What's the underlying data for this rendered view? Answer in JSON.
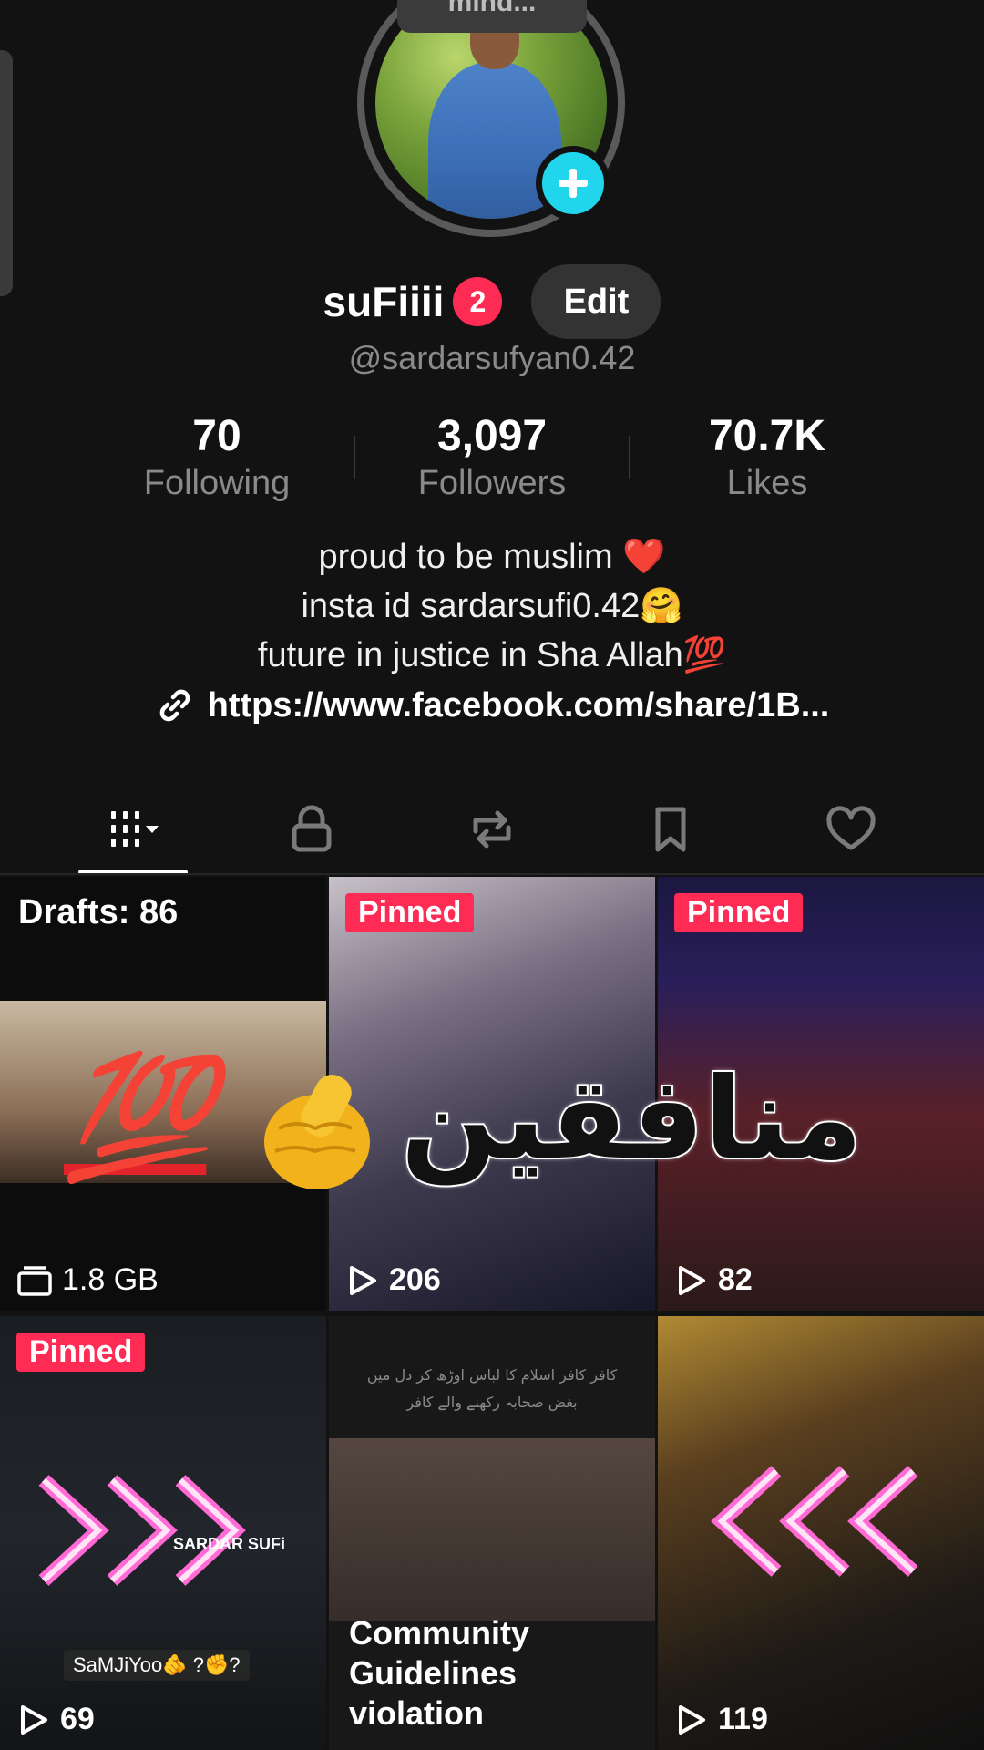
{
  "profile": {
    "tooltip": "mind...",
    "username": "suFiiii",
    "badge_count": "2",
    "edit_label": "Edit",
    "handle": "@sardarsufyan0.42"
  },
  "stats": [
    {
      "value": "70",
      "label": "Following"
    },
    {
      "value": "3,097",
      "label": "Followers"
    },
    {
      "value": "70.7K",
      "label": "Likes"
    }
  ],
  "bio": {
    "lines": [
      "proud to be muslim ❤️",
      "insta id sardarsufi0.42🤗",
      "future in justice in Sha Allah💯"
    ],
    "link": "https://www.facebook.com/share/1B..."
  },
  "tabs": [
    {
      "icon": "grid-videos-icon",
      "active": true
    },
    {
      "icon": "lock-icon",
      "active": false
    },
    {
      "icon": "repost-icon",
      "active": false
    },
    {
      "icon": "bookmark-icon",
      "active": false
    },
    {
      "icon": "heart-icon",
      "active": false
    }
  ],
  "grid": {
    "drafts": {
      "label": "Drafts: 86",
      "size": "1.8 GB"
    },
    "overlay_sticker": "💯",
    "overlay_arabic": "منافقین",
    "items": [
      {
        "pinned": "Pinned",
        "views": "206"
      },
      {
        "pinned": "Pinned",
        "views": "82"
      },
      {
        "pinned": "Pinned",
        "views": "69",
        "watermark": "SARDAR SUFi",
        "caption": "SaMJiYoo🫵 ?✊?"
      },
      {
        "violation": "Community Guidelines violation",
        "urdu": "کافر کافر اسلام کا لباس اوڑھ کر دل میں بغض صحابہ رکھنے والے کافر"
      },
      {
        "views": "119"
      }
    ]
  },
  "colors": {
    "accent_pink": "#fe2c55",
    "accent_cyan": "#20d5ec",
    "background": "#121212"
  }
}
